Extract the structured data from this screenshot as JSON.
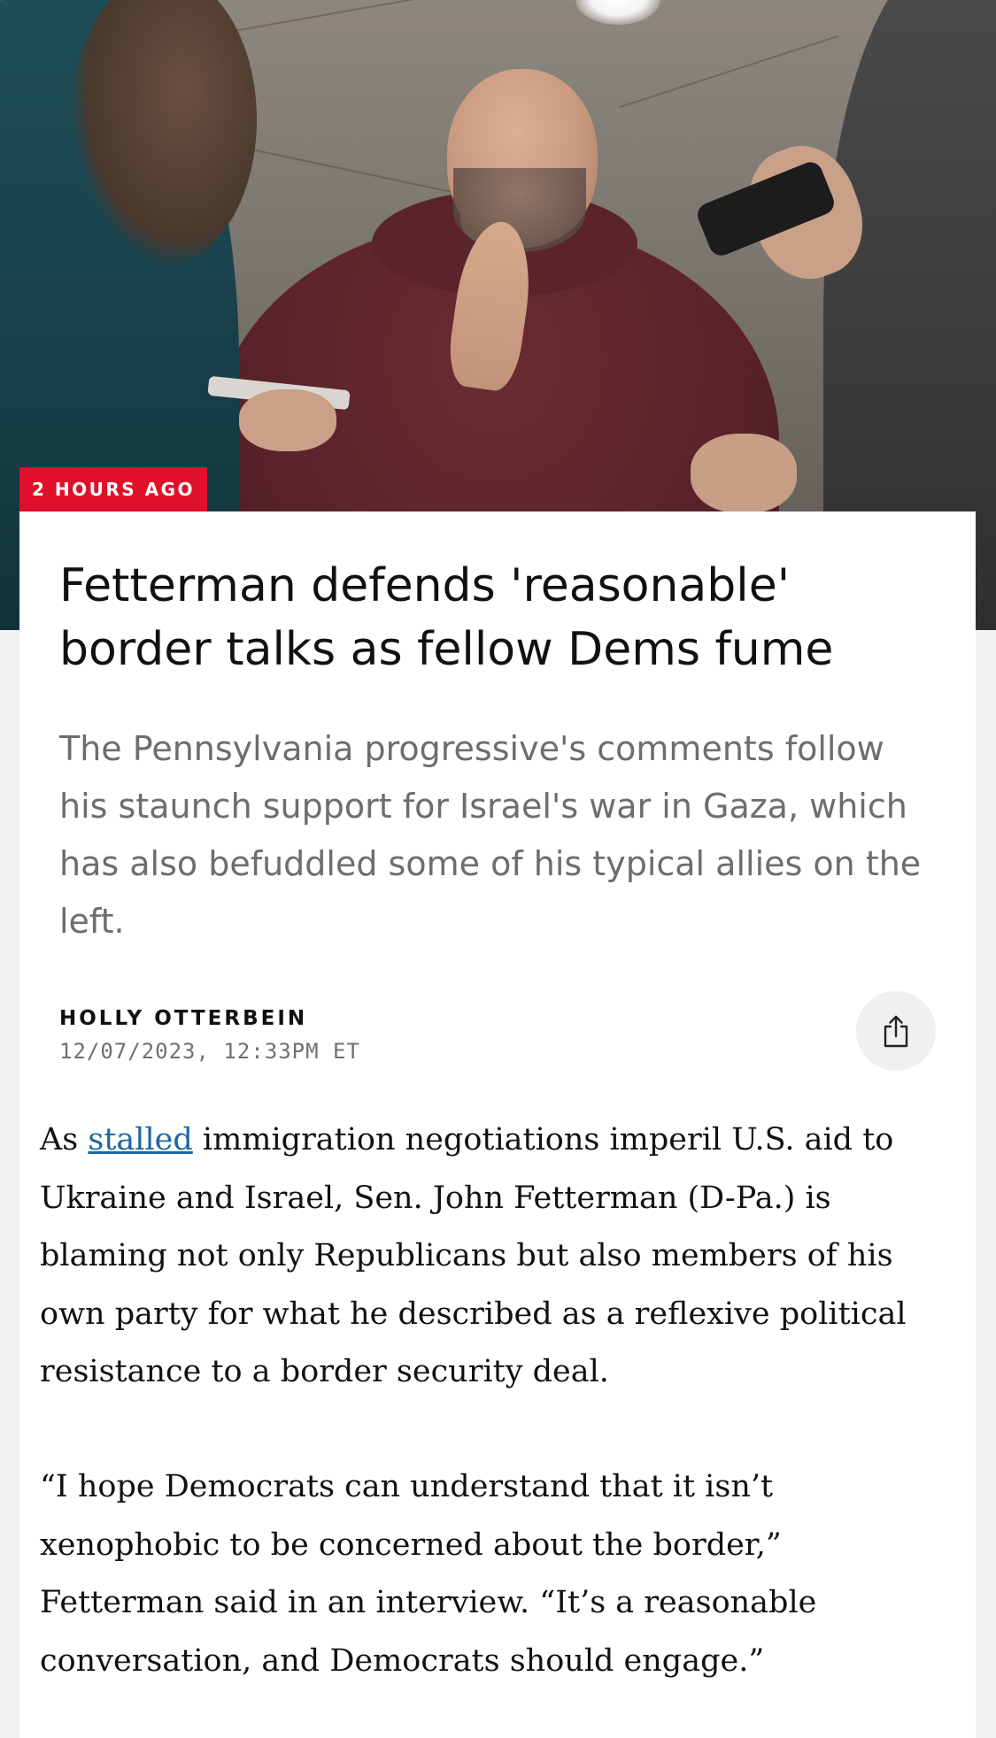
{
  "hero": {
    "timestamp_badge": "2 HOURS AGO",
    "badge_color": "#e0102b"
  },
  "article": {
    "headline": "Fetterman defends 'reasonable' border talks as fellow Dems fume",
    "dek": "The Pennsylvania progressive's comments follow his staunch support for Israel's war in Gaza, which has also befuddled some of his typical allies on the left.",
    "author": "HOLLY OTTERBEIN",
    "date": "12/07/2023, 12:33PM ET",
    "share_icon": "share-icon",
    "paragraph1": {
      "before_link": "As ",
      "link_text": "stalled",
      "after_link": " immigration negotiations imperil U.S. aid to Ukraine and Israel, Sen. John Fetterman (D-Pa.) is blaming not only Republicans but also members of his own party for what he described as a reflexive political resistance to a border security deal."
    },
    "paragraph2": "“I hope Democrats can understand that it isn’t xenophobic to be concerned about the border,” Fetterman said in an interview. “It’s a reasonable conversation, and Democrats should engage.”",
    "link_color": "#1a66a6"
  }
}
